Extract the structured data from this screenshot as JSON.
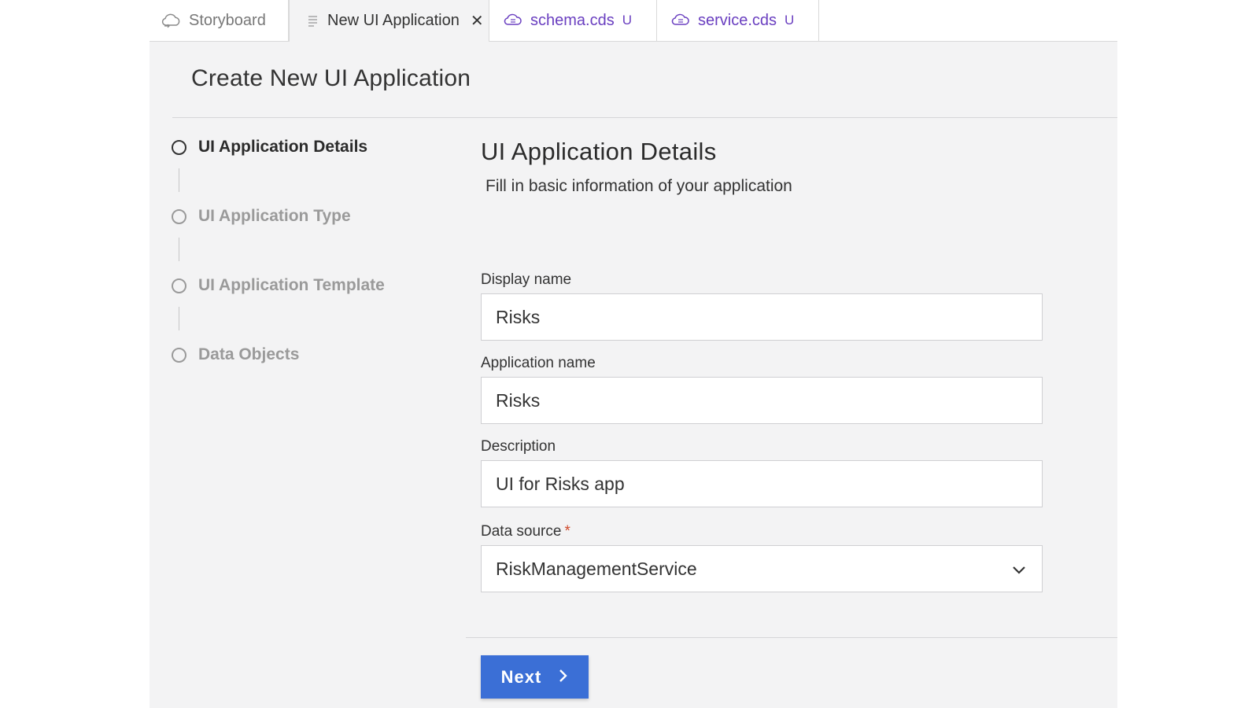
{
  "tabs": [
    {
      "label": "Storyboard",
      "icon": "cloud-icon",
      "state": "inactive"
    },
    {
      "label": "New UI Application",
      "icon": "document-lines-icon",
      "state": "active",
      "close_icon": "close-icon",
      "close_glyph": "✕"
    },
    {
      "label": "schema.cds",
      "icon": "cds-cloud-icon",
      "state": "modified",
      "badge": "U"
    },
    {
      "label": "service.cds",
      "icon": "cds-cloud-icon",
      "state": "modified",
      "badge": "U"
    }
  ],
  "page": {
    "title": "Create New UI Application"
  },
  "steps": [
    {
      "label": "UI Application Details",
      "status": "current"
    },
    {
      "label": "UI Application Type",
      "status": "pending"
    },
    {
      "label": "UI Application Template",
      "status": "pending"
    },
    {
      "label": "Data Objects",
      "status": "pending"
    }
  ],
  "form": {
    "section_title": "UI Application Details",
    "section_subtitle": "Fill in basic information of your application",
    "display_name": {
      "label": "Display name",
      "value": "Risks"
    },
    "application_name": {
      "label": "Application name",
      "value": "Risks"
    },
    "description": {
      "label": "Description",
      "value": "UI for Risks app"
    },
    "data_source": {
      "label": "Data source",
      "required_marker": "*",
      "value": "RiskManagementService",
      "icon": "chevron-down-icon"
    }
  },
  "footer": {
    "next_label": "Next",
    "next_icon": "chevron-right-icon"
  },
  "colors": {
    "accent": "#3b6fd6",
    "modified_tab": "#6a3fc0",
    "required": "#d04a2c",
    "panel_bg": "#f3f3f4"
  }
}
